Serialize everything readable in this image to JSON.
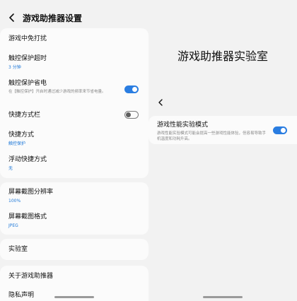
{
  "left_panel": {
    "header": {
      "title": "游戏助推器设置"
    },
    "items": {
      "no_disturb": {
        "label": "游戏中免打扰"
      },
      "touch_timeout": {
        "label": "触控保护超时",
        "value": "3 分钟"
      },
      "touch_power_save": {
        "label": "触控保护省电",
        "description": "在【触控保护】开启时通过减少游戏的频率来节省电量。",
        "toggle": "on"
      },
      "shortcut_bar": {
        "label": "快捷方式栏",
        "toggle": "off"
      },
      "shortcut": {
        "label": "快捷方式",
        "value": "触控保护"
      },
      "floating_shortcut": {
        "label": "浮动快捷方式",
        "value": "无"
      },
      "screenshot_resolution": {
        "label": "屏幕截图分辨率",
        "value": "100%"
      },
      "screenshot_format": {
        "label": "屏幕截图格式",
        "value": "JPEG"
      },
      "lab": {
        "label": "实验室"
      },
      "about": {
        "label": "关于游戏助推器"
      },
      "partial": {
        "label": "隐私声明"
      }
    }
  },
  "right_panel": {
    "title": "游戏助推器实验室",
    "performance_mode": {
      "label": "游戏性能实验模式",
      "description": "游戏性能实验模式可能会提高一些游戏性能体验，但容易导致手机温度和功耗升高。",
      "toggle": "on"
    }
  },
  "colors": {
    "accent": "#2a7de1",
    "value_text": "#1e78d8",
    "background": "#f2f2f2",
    "card": "#fbfbfb"
  }
}
